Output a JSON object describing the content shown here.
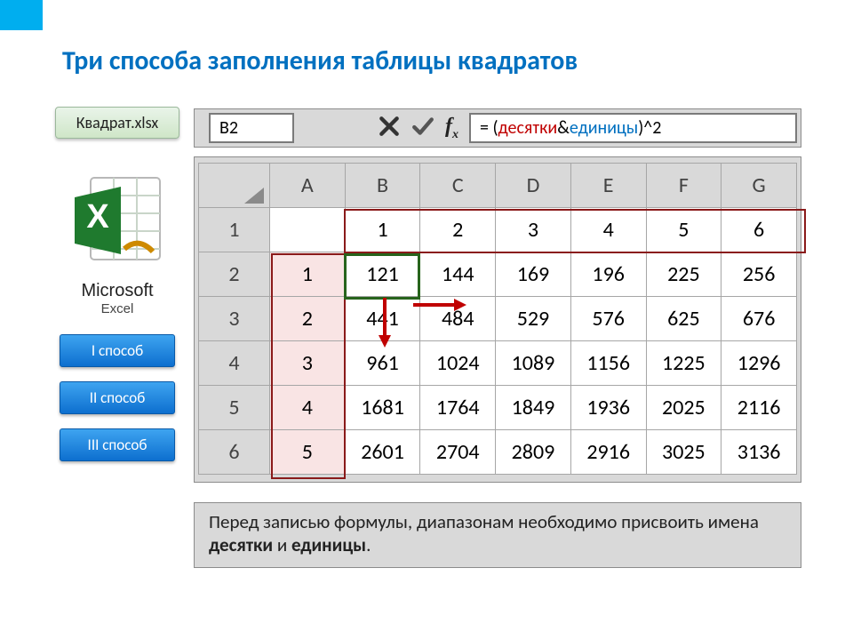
{
  "title": "Три способа заполнения таблицы квадратов",
  "file_name": "Квадрат.xlsx",
  "app": {
    "line1": "Microsoft",
    "line2": "Excel"
  },
  "buttons": {
    "m1": "I способ",
    "m2": "II способ",
    "m3": "III способ"
  },
  "formula_bar": {
    "cell_ref": "B2",
    "formula_prefix": "= (",
    "formula_red": "десятки",
    "formula_mid": " & ",
    "formula_blue": "единицы",
    "formula_suffix": ")^2"
  },
  "sheet": {
    "col_headers": [
      "A",
      "B",
      "C",
      "D",
      "E",
      "F",
      "G"
    ],
    "row_headers": [
      "1",
      "2",
      "3",
      "4",
      "5",
      "6"
    ],
    "row1": [
      "",
      "1",
      "2",
      "3",
      "4",
      "5",
      "6"
    ],
    "colA": [
      "1",
      "2",
      "3",
      "4",
      "5"
    ],
    "grid": [
      [
        "121",
        "144",
        "169",
        "196",
        "225",
        "256"
      ],
      [
        "441",
        "484",
        "529",
        "576",
        "625",
        "676"
      ],
      [
        "961",
        "1024",
        "1089",
        "1156",
        "1225",
        "1296"
      ],
      [
        "1681",
        "1764",
        "1849",
        "1936",
        "2025",
        "2116"
      ],
      [
        "2601",
        "2704",
        "2809",
        "2916",
        "3025",
        "3136"
      ]
    ]
  },
  "footer": {
    "t1": "Перед записью формулы, диапазонам необходимо присвоить имена ",
    "b1": "десятки",
    "t2": " и ",
    "b2": "единицы",
    "t3": "."
  },
  "chart_data": {
    "type": "table",
    "title": "Таблица квадратов",
    "row_labels_tens": [
      1,
      2,
      3,
      4,
      5
    ],
    "col_labels_units": [
      1,
      2,
      3,
      4,
      5,
      6
    ],
    "values": [
      [
        121,
        144,
        169,
        196,
        225,
        256
      ],
      [
        441,
        484,
        529,
        576,
        625,
        676
      ],
      [
        961,
        1024,
        1089,
        1156,
        1225,
        1296
      ],
      [
        1681,
        1764,
        1849,
        1936,
        2025,
        2116
      ],
      [
        2601,
        2704,
        2809,
        2916,
        3025,
        3136
      ]
    ]
  }
}
